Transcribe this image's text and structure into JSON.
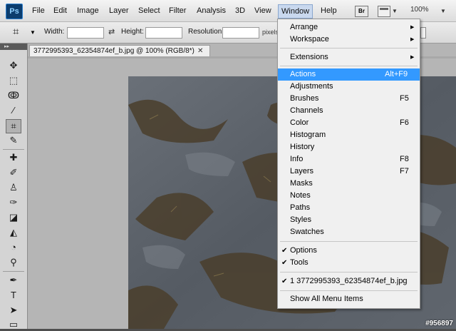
{
  "app": {
    "logo": "Ps"
  },
  "menubar": {
    "items": [
      "File",
      "Edit",
      "Image",
      "Layer",
      "Select",
      "Filter",
      "Analysis",
      "3D",
      "View",
      "Window",
      "Help"
    ],
    "bridge_label": "Br",
    "zoom": "100%"
  },
  "options": {
    "width_label": "Width:",
    "height_label": "Height:",
    "resolution_label": "Resolution:",
    "resolution_unit": "pixels"
  },
  "document": {
    "tab_title": "3772995393_62354874ef_b.jpg @ 100% (RGB/8*)",
    "watermark": "#956897"
  },
  "window_menu": {
    "arrange": "Arrange",
    "workspace": "Workspace",
    "extensions": "Extensions",
    "panels": [
      {
        "label": "Actions",
        "shortcut": "Alt+F9"
      },
      {
        "label": "Adjustments",
        "shortcut": ""
      },
      {
        "label": "Brushes",
        "shortcut": "F5"
      },
      {
        "label": "Channels",
        "shortcut": ""
      },
      {
        "label": "Color",
        "shortcut": "F6"
      },
      {
        "label": "Histogram",
        "shortcut": ""
      },
      {
        "label": "History",
        "shortcut": ""
      },
      {
        "label": "Info",
        "shortcut": "F8"
      },
      {
        "label": "Layers",
        "shortcut": "F7"
      },
      {
        "label": "Masks",
        "shortcut": ""
      },
      {
        "label": "Notes",
        "shortcut": ""
      },
      {
        "label": "Paths",
        "shortcut": ""
      },
      {
        "label": "Styles",
        "shortcut": ""
      },
      {
        "label": "Swatches",
        "shortcut": ""
      }
    ],
    "options": "Options",
    "tools": "Tools",
    "open_document": "1 3772995393_62354874ef_b.jpg",
    "show_all": "Show All Menu Items",
    "highlight_color": "#3399ff"
  }
}
